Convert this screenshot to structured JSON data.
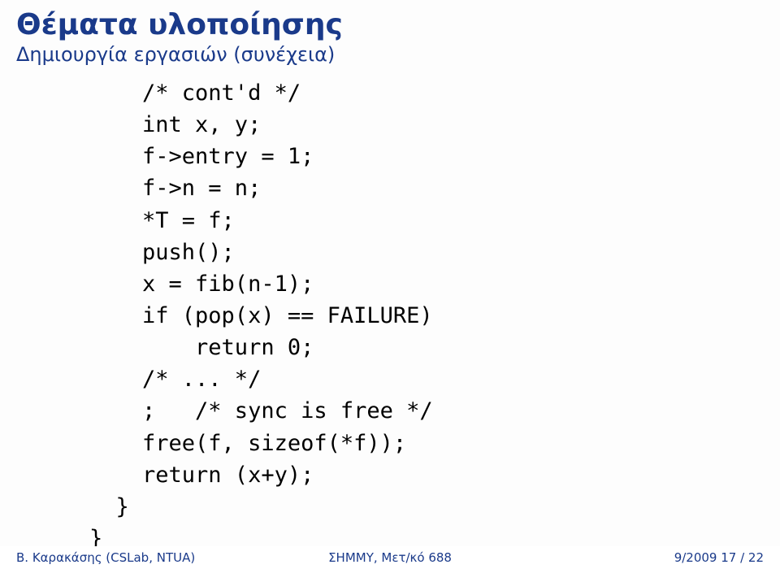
{
  "title": "Θέματα υλοποίησης",
  "subtitle": "Δημιουργία εργασιών (συνέχεια)",
  "code": {
    "l1": "    /* cont'd */",
    "l2": "    int x, y;",
    "l3": "    f->entry = 1;",
    "l4": "    f->n = n;",
    "l5": "    *T = f;",
    "l6": "    push();",
    "l7": "    x = fib(n-1);",
    "l8": "    if (pop(x) == FAILURE)",
    "l9": "        return 0;",
    "l10": "    /* ... */",
    "l11": "    ;   /* sync is free */",
    "l12": "    free(f, sizeof(*f));",
    "l13": "    return (x+y);",
    "l14": "  }",
    "l15": "}"
  },
  "footer": {
    "left": "Β. Καρακάσης (CSLab, NTUA)",
    "center": "ΣΗΜΜΥ, Μετ/κό 688",
    "right": "9/2009   17 / 22"
  }
}
